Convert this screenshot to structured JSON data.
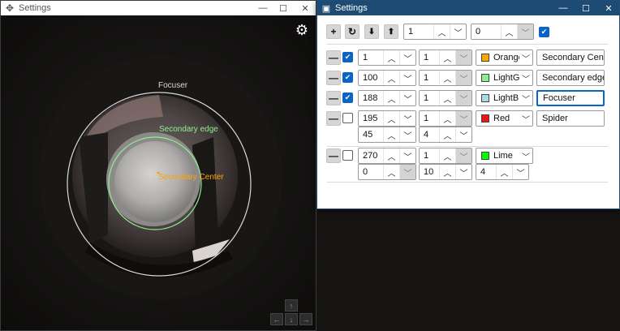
{
  "viewer_window": {
    "title": "Settings",
    "icon": "diamond-move-icon",
    "overlay": {
      "focuser_label": "Focuser",
      "secondary_edge_label": "Secondary edge",
      "secondary_center_label": "Secondary Center",
      "colors": {
        "focuser": "#d8d8d8",
        "secondary_edge": "#90ee90",
        "secondary_center": "#ffa500"
      }
    },
    "nav_icons": [
      "arrow-up-icon",
      "arrow-left-icon",
      "arrow-down-icon",
      "arrow-right-icon"
    ]
  },
  "settings_window": {
    "title": "Settings",
    "toolbar": {
      "add_icon": "plus-icon",
      "reset_icon": "refresh-icon",
      "download_icon": "download-icon",
      "upload_icon": "upload-icon",
      "value1": "1",
      "value2": "0",
      "checked": true
    },
    "rows": [
      {
        "enabled": true,
        "radius": "1",
        "width": "1",
        "color_name": "Orange",
        "color": "#ffa500",
        "label": "Secondary Center"
      },
      {
        "enabled": true,
        "radius": "100",
        "width": "1",
        "color_name": "LightGre",
        "color": "#90ee90",
        "label": "Secondary edge"
      },
      {
        "enabled": true,
        "radius": "188",
        "width": "1",
        "color_name": "LightBlue",
        "color": "#add8e6",
        "label": "Focuser"
      },
      {
        "enabled": false,
        "radius": "195",
        "width": "1",
        "color_name": "Red",
        "color": "#e81818",
        "label": "Spider",
        "extra1": "45",
        "extra2": "4"
      },
      {
        "enabled": false,
        "radius": "270",
        "width": "1",
        "color_name": "Lime",
        "color": "#00ff00",
        "label": "",
        "extra1": "0",
        "extra2": "10",
        "extra3": "4"
      }
    ]
  }
}
